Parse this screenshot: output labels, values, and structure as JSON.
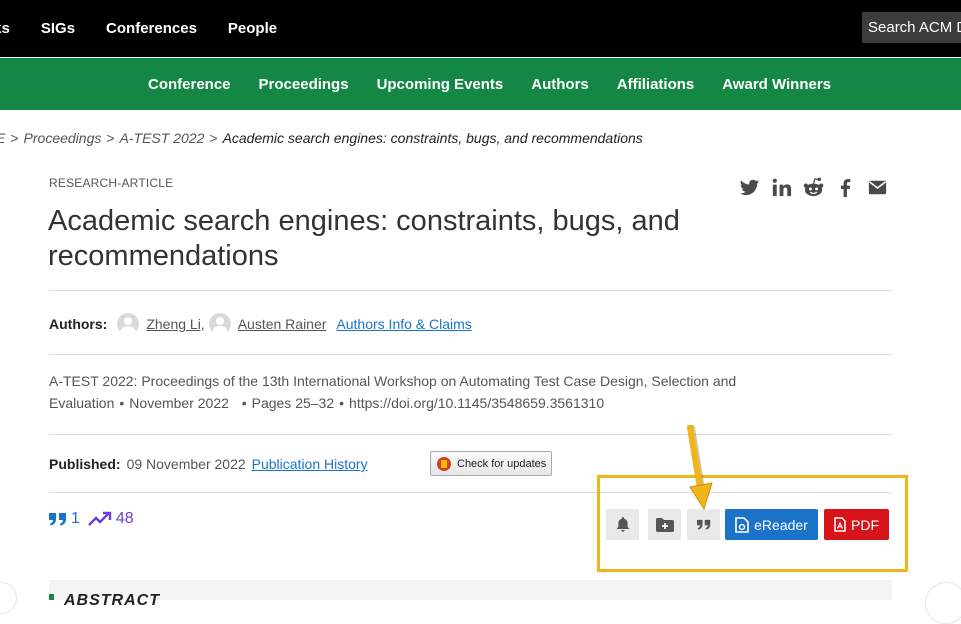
{
  "top_nav": {
    "items": [
      "oks",
      "SIGs",
      "Conferences",
      "People"
    ],
    "search_placeholder": "Search ACM DL"
  },
  "sub_nav": {
    "items": [
      "Conference",
      "Proceedings",
      "Upcoming Events",
      "Authors",
      "Affiliations",
      "Award Winners"
    ]
  },
  "breadcrumb": {
    "items": [
      "E",
      "Proceedings",
      "A-TEST 2022",
      "Academic search engines: constraints, bugs, and recommendations"
    ]
  },
  "article": {
    "type": "RESEARCH-ARTICLE",
    "title": "Academic search engines: constraints, bugs, and recommendations",
    "authors_label": "Authors:",
    "authors": [
      "Zheng Li,",
      "Austen Rainer"
    ],
    "authors_info_link": "Authors Info & Claims",
    "venue_line1": "A-TEST 2022: Proceedings of the 13th International Workshop on Automating Test Case Design, Selection and",
    "venue_word": "Evaluation",
    "venue_date": "November 2022",
    "venue_pages": "Pages 25–32",
    "venue_doi": "https://doi.org/10.1145/3548659.3561310",
    "published_label": "Published:",
    "published_date": "09 November 2022",
    "publication_history": "Publication History",
    "check_updates": "Check for updates",
    "citations": "1",
    "downloads": "48"
  },
  "share_icons": [
    "twitter-icon",
    "linkedin-icon",
    "reddit-icon",
    "facebook-icon",
    "email-icon"
  ],
  "actions": {
    "ereader": "eReader",
    "pdf": "PDF"
  },
  "abstract_heading": "ABSTRACT",
  "colors": {
    "green": "#158744",
    "blue": "#1a73c8",
    "red": "#d8141b",
    "highlight": "#f1b51c",
    "purple": "#6b3fd6"
  }
}
